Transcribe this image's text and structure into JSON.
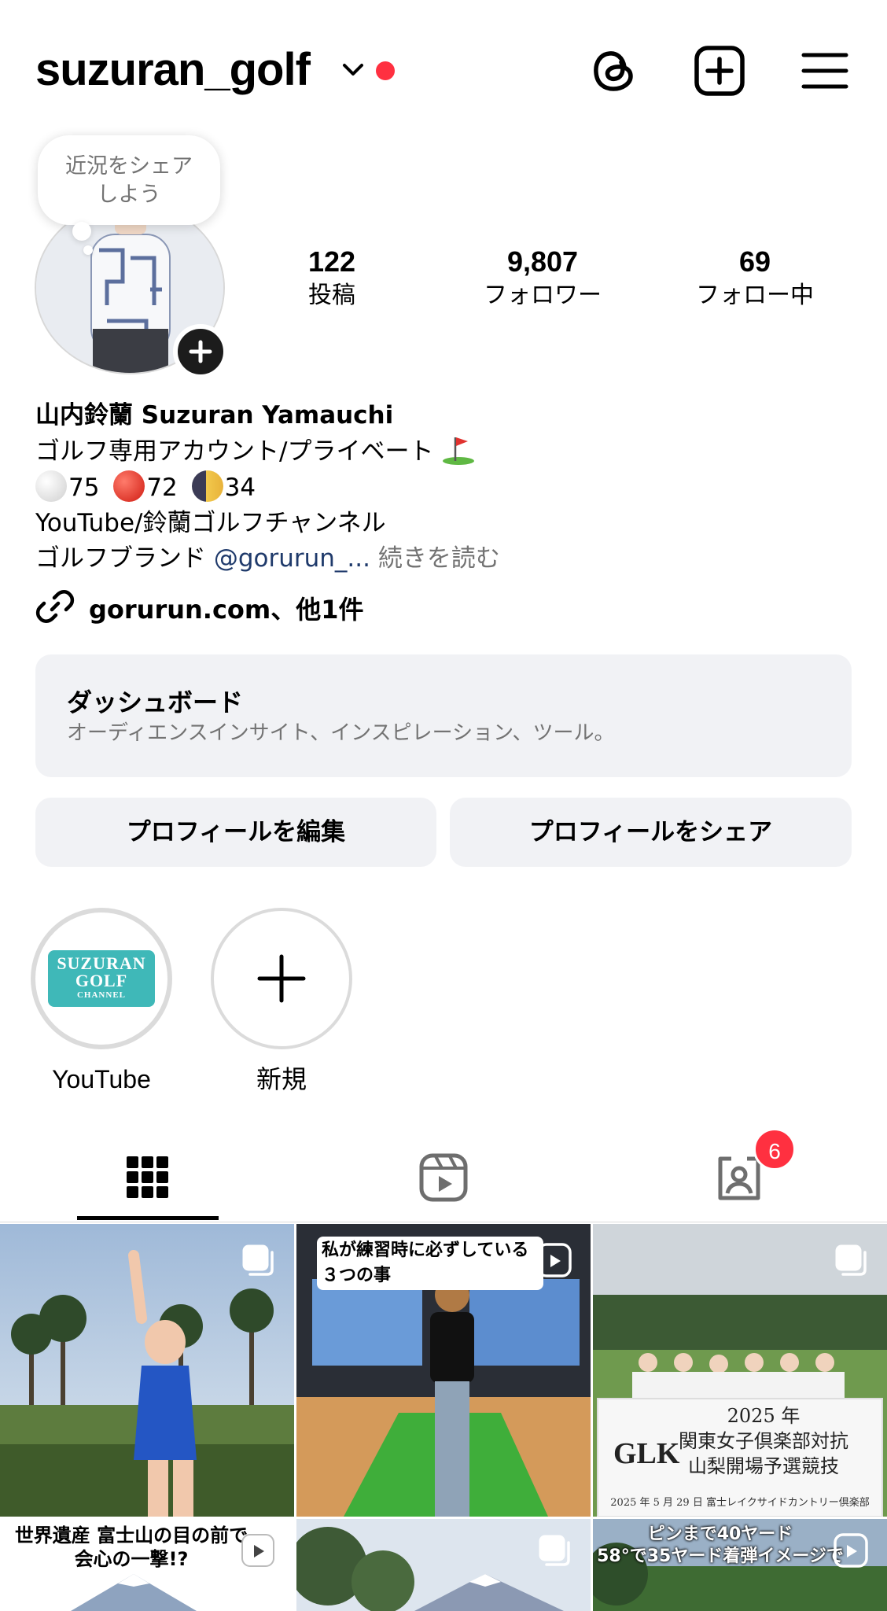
{
  "header": {
    "username": "suzuran_golf",
    "icons": [
      "chevron-down-icon",
      "notification-dot",
      "threads-icon",
      "create-post-icon",
      "menu-icon"
    ],
    "dot_color": "#ff3040"
  },
  "profile": {
    "note_bubble_line1": "近況をシェア",
    "note_bubble_line2": "しよう",
    "stats": [
      {
        "value": "122",
        "label": "投稿"
      },
      {
        "value": "9,807",
        "label": "フォロワー"
      },
      {
        "value": "69",
        "label": "フォロー中"
      }
    ]
  },
  "bio": {
    "name": "山内鈴蘭  Suzuran Yamauchi",
    "line1": "ゴルフ専用アカウント/プライベート",
    "line2_a": "75",
    "line2_b": "72",
    "line2_c": "34",
    "line3": "YouTube/鈴蘭ゴルフチャンネル",
    "line4_prefix": "ゴルフブランド ",
    "line4_mention": "@gorurun_...",
    "line4_more": " 続きを読む",
    "link": "gorurun.com、他1件"
  },
  "dashboard": {
    "title": "ダッシュボード",
    "subtitle": "オーディエンスインサイト、インスピレーション、ツール。"
  },
  "buttons": {
    "edit": "プロフィールを編集",
    "share": "プロフィールをシェア"
  },
  "highlights": [
    {
      "label": "YouTube",
      "logo_line1": "SUZURAN",
      "logo_line2": "GOLF",
      "logo_line3": "CHANNEL"
    },
    {
      "label": "新規"
    }
  ],
  "tabs": {
    "items": [
      "grid-tab",
      "reels-tab",
      "tagged-tab"
    ],
    "tagged_badge": "6"
  },
  "grid": {
    "post2_caption": "私が練習時に必ずしている３つの事",
    "post3_sign_line1": "2025 年",
    "post3_sign_line2": "関東女子倶楽部対抗",
    "post3_sign_line3": "山梨開場予選競技",
    "post3_sign_line4": "2025 年 5 月 29 日  富士レイクサイドカントリー倶楽部",
    "post4_caption_line1": "世界遺産 富士山の目の前で",
    "post4_caption_line2": "会心の一撃!?",
    "post6_caption_line1": "ピンまで40ヤード",
    "post6_caption_line2": "58°で35ヤード着弾イメージで"
  }
}
